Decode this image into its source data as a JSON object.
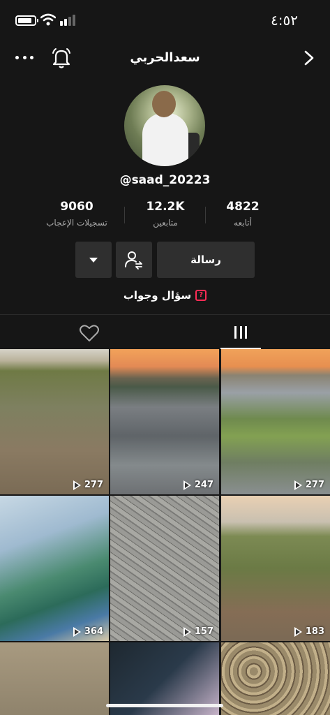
{
  "status_bar": {
    "time": "٤:٥٢"
  },
  "header": {
    "title": "سعدالحربي"
  },
  "profile": {
    "handle": "@saad_20223",
    "stats": [
      {
        "value": "9060",
        "label": "تسجيلات الإعجاب"
      },
      {
        "value": "12.2K",
        "label": "متابعين"
      },
      {
        "value": "4822",
        "label": "أتابعه"
      }
    ]
  },
  "actions": {
    "message_label": "رسالة"
  },
  "qa": {
    "label": "سؤال وجواب"
  },
  "tabs": {
    "active": "videos"
  },
  "videos": [
    {
      "views": "277"
    },
    {
      "views": "247"
    },
    {
      "views": "277"
    },
    {
      "views": "364"
    },
    {
      "views": "157"
    },
    {
      "views": "183"
    }
  ],
  "icons": {
    "more": "more-icon",
    "bell": "bell-icon",
    "back": "chevron-right-icon",
    "dropdown": "caret-down-icon",
    "follow": "add-friend-icon",
    "qa": "qa-icon",
    "liked": "heart-icon",
    "videos": "grid-icon",
    "play": "play-icon"
  },
  "colors": {
    "background": "#161616",
    "button": "#2f2f2f",
    "accent": "#fe2c55"
  }
}
